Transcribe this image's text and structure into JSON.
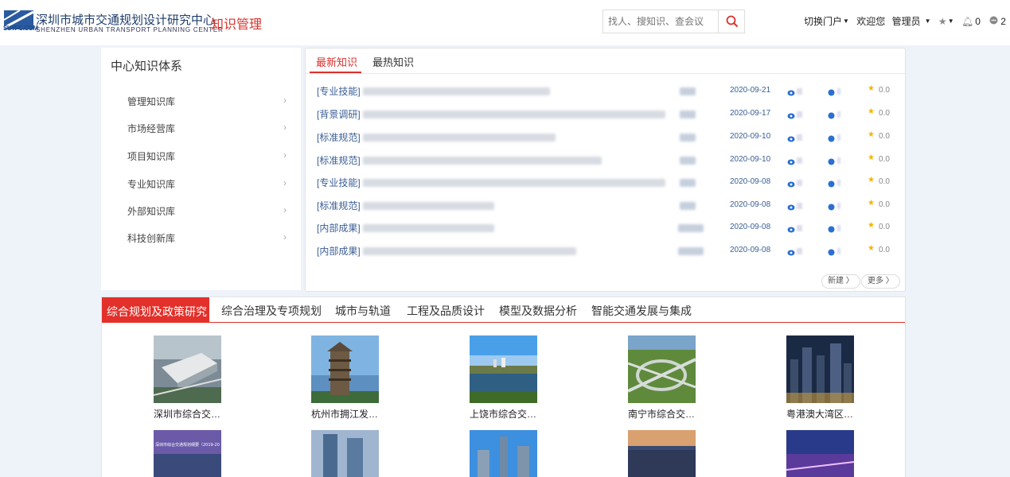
{
  "header": {
    "logo_abbr": "SUTPC.COM",
    "logo_cn": "深圳市城市交通规划设计研究中心",
    "logo_en": "SHENZHEN URBAN TRANSPORT PLANNING CENTER",
    "app_title": "知识管理",
    "search_placeholder": "找人、搜知识、查会议",
    "switch_portal": "切换门户",
    "welcome": "欢迎您",
    "user": "管理员",
    "notify_count": "0",
    "msg_count": "2"
  },
  "sidebar": {
    "title": "中心知识体系",
    "items": [
      {
        "label": "管理知识库"
      },
      {
        "label": "市场经营库"
      },
      {
        "label": "项目知识库"
      },
      {
        "label": "专业知识库"
      },
      {
        "label": "外部知识库"
      },
      {
        "label": "科技创新库"
      }
    ]
  },
  "news": {
    "tabs": [
      {
        "label": "最新知识",
        "active": true
      },
      {
        "label": "最热知识",
        "active": false
      }
    ],
    "rows": [
      {
        "category": "[专业技能]",
        "date": "2020-09-21",
        "score": "0.0"
      },
      {
        "category": "[背景调研]",
        "date": "2020-09-17",
        "score": "0.0"
      },
      {
        "category": "[标准规范]",
        "date": "2020-09-10",
        "score": "0.0"
      },
      {
        "category": "[标准规范]",
        "date": "2020-09-10",
        "score": "0.0"
      },
      {
        "category": "[专业技能]",
        "date": "2020-09-08",
        "score": "0.0"
      },
      {
        "category": "[标准规范]",
        "date": "2020-09-08",
        "score": "0.0"
      },
      {
        "category": "[内部成果]",
        "date": "2020-09-08",
        "score": "0.0"
      },
      {
        "category": "[内部成果]",
        "date": "2020-09-08",
        "score": "0.0"
      }
    ],
    "new_label": "新建 〉",
    "more_label": "更多 〉"
  },
  "categories": {
    "tabs": [
      {
        "label": "综合规划及政策研究",
        "active": true
      },
      {
        "label": "综合治理及专项规划",
        "active": false
      },
      {
        "label": "城市与轨道",
        "active": false
      },
      {
        "label": "工程及品质设计",
        "active": false
      },
      {
        "label": "模型及数据分析",
        "active": false
      },
      {
        "label": "智能交通发展与集成",
        "active": false
      }
    ],
    "cards": [
      {
        "caption": "深圳市综合交…"
      },
      {
        "caption": "杭州市拥江发…"
      },
      {
        "caption": "上饶市综合交…"
      },
      {
        "caption": "南宁市综合交…"
      },
      {
        "caption": "粤港澳大湾区…"
      }
    ],
    "second_row_banner": "深圳市综合交通规划纲要（2019-20"
  },
  "colors": {
    "accent": "#d9322c",
    "link": "#3a5e96",
    "background": "#eef2f9"
  }
}
